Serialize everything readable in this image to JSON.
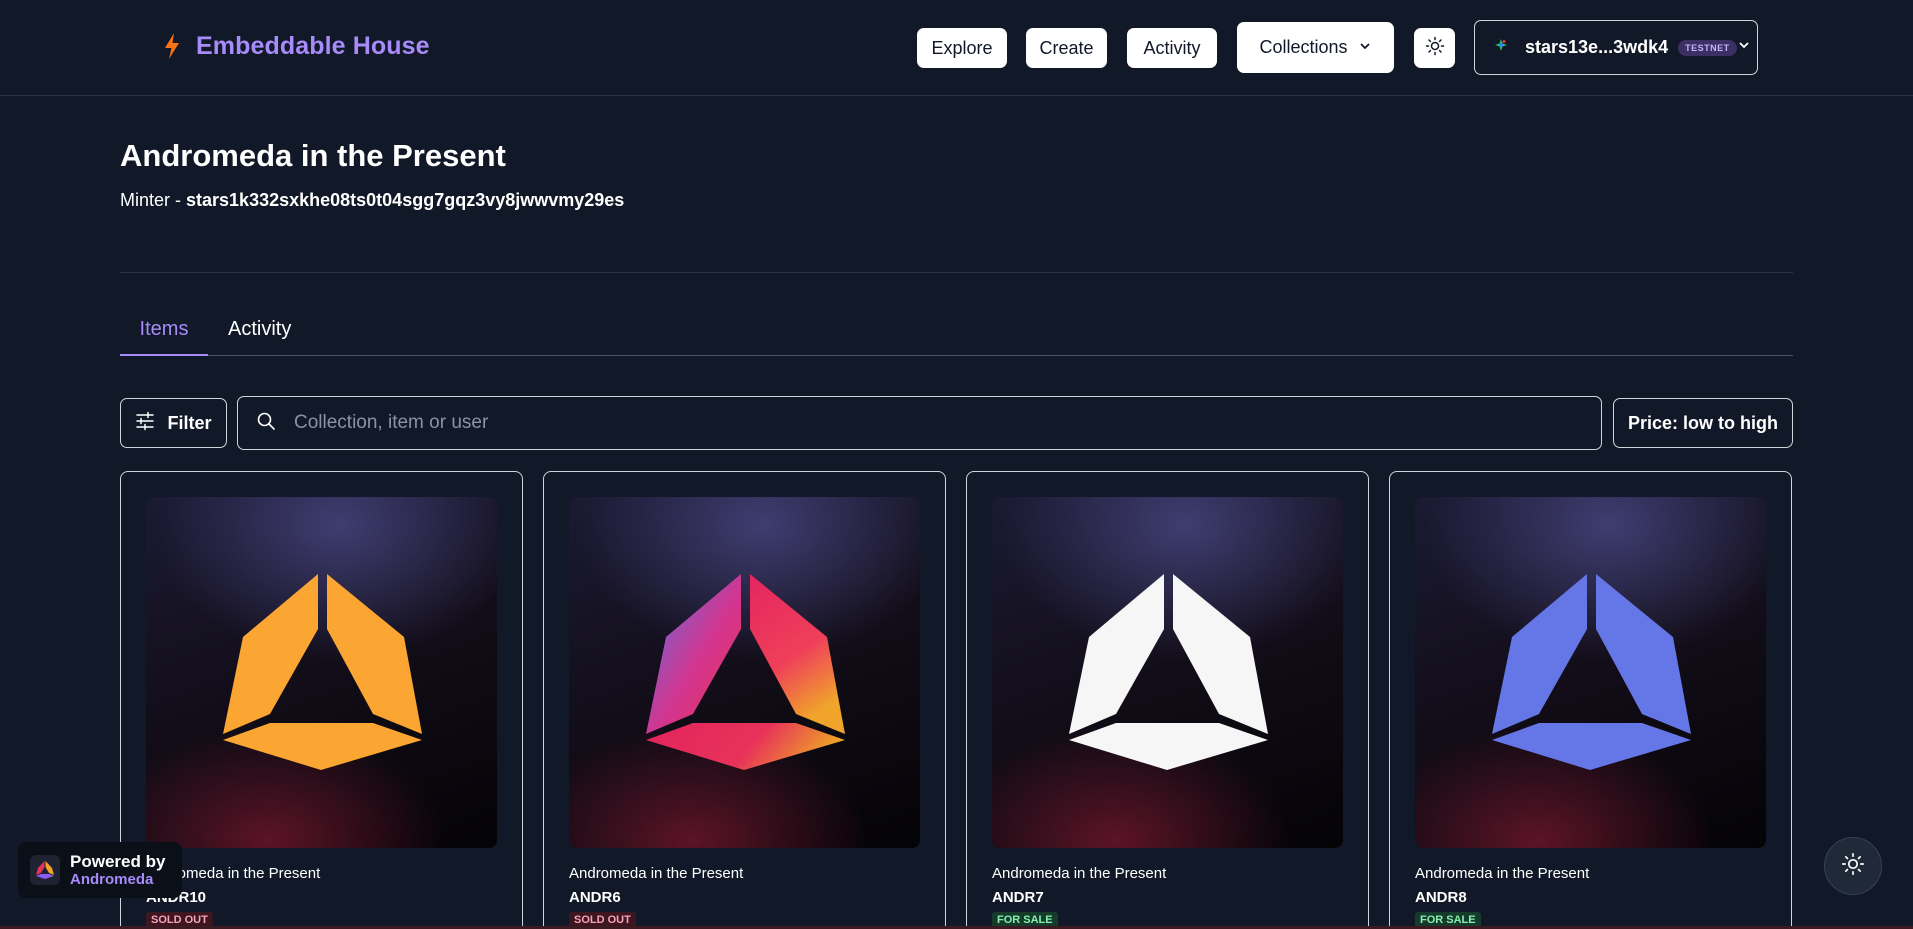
{
  "header": {
    "brand": "Embeddable House",
    "nav": {
      "explore": "Explore",
      "create": "Create",
      "activity": "Activity",
      "collections": "Collections"
    },
    "wallet": {
      "address": "stars13e...3wdk4",
      "network": "TESTNET"
    }
  },
  "collection": {
    "title": "Andromeda in the Present",
    "minter_label": "Minter - ",
    "minter_address": "stars1k332sxkhe08ts0t04sgg7gqz3vy8jwwvmy29es"
  },
  "tabs": {
    "items": "Items",
    "activity": "Activity"
  },
  "toolbar": {
    "filter": "Filter",
    "search_placeholder": "Collection, item or user",
    "sort": "Price: low to high"
  },
  "cards": [
    {
      "name": "Andromeda in the Present",
      "token": "ANDR10",
      "status": "SOLD OUT",
      "fill": "orange"
    },
    {
      "name": "Andromeda in the Present",
      "token": "ANDR6",
      "status": "SOLD OUT",
      "fill": "gradient"
    },
    {
      "name": "Andromeda in the Present",
      "token": "ANDR7",
      "status": "FOR SALE",
      "fill": "white"
    },
    {
      "name": "Andromeda in the Present",
      "token": "ANDR8",
      "status": "FOR SALE",
      "fill": "blue"
    }
  ],
  "powered": {
    "line1": "Powered by",
    "line2": "Andromeda"
  },
  "colors": {
    "background": "#111827",
    "accent": "#a78bfa",
    "orange_logo": "#fba632",
    "blue_logo": "#6576e6"
  }
}
